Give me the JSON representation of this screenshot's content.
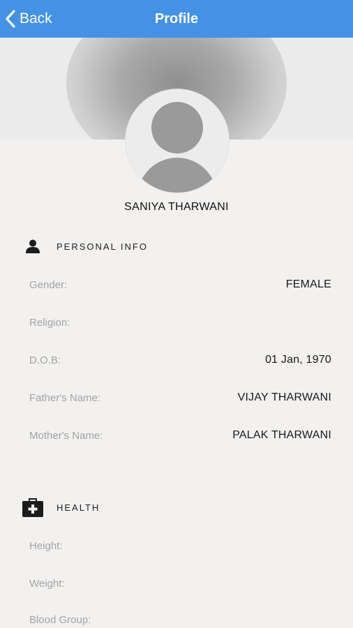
{
  "navbar": {
    "back_label": "Back",
    "title": "Profile",
    "color": "#4392e6"
  },
  "profile": {
    "name": "SANIYA THARWANI",
    "avatar_icon": "default-avatar-icon"
  },
  "personal_info": {
    "title": "PERSONAL INFO",
    "icon": "person-icon",
    "rows": [
      {
        "label": "Gender:",
        "value": "FEMALE"
      },
      {
        "label": "Religion:",
        "value": ""
      },
      {
        "label": "D.O.B:",
        "value": "01 Jan, 1970"
      },
      {
        "label": "Father's Name:",
        "value": "VIJAY THARWANI"
      },
      {
        "label": "Mother's Name:",
        "value": "PALAK THARWANI"
      }
    ]
  },
  "health": {
    "title": "HEALTH",
    "icon": "medical-kit-icon",
    "rows": [
      {
        "label": "Height:",
        "value": ""
      },
      {
        "label": "Weight:",
        "value": ""
      },
      {
        "label": "Blood Group:",
        "value": ""
      }
    ]
  }
}
